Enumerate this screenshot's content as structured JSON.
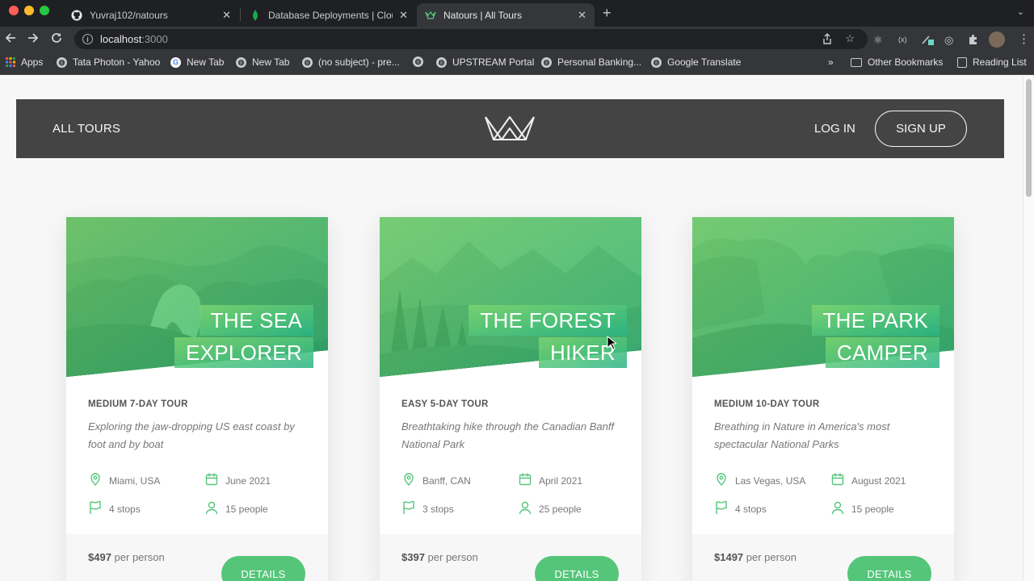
{
  "browser": {
    "tabs": [
      {
        "title": "Yuvraj102/natours",
        "icon": "github-icon"
      },
      {
        "title": "Database Deployments | Cloud",
        "icon": "mongodb-leaf-icon"
      },
      {
        "title": "Natours | All Tours",
        "icon": "natours-logo-icon"
      }
    ],
    "url_host": "localhost",
    "url_port": ":3000",
    "bookmarks": [
      {
        "label": "Apps",
        "icon": "apps-grid-icon"
      },
      {
        "label": "Tata Photon - Yahoo",
        "icon": "globe-icon"
      },
      {
        "label": "New Tab",
        "icon": "google-icon"
      },
      {
        "label": "New Tab",
        "icon": "globe-icon"
      },
      {
        "label": "(no subject) - pre...",
        "icon": "globe-icon"
      },
      {
        "label": "",
        "icon": "globe-icon"
      },
      {
        "label": "UPSTREAM Portal",
        "icon": "globe-icon"
      },
      {
        "label": "Personal Banking...",
        "icon": "globe-icon"
      },
      {
        "label": "Google Translate",
        "icon": "globe-icon"
      }
    ],
    "bookmarks_overflow": "»",
    "other_bookmarks": "Other Bookmarks",
    "reading_list": "Reading List"
  },
  "header": {
    "all_tours": "ALL TOURS",
    "login": "LOG IN",
    "signup": "SIGN UP"
  },
  "tours": [
    {
      "name": "THE SEA EXPLORER",
      "name_lines": [
        "THE SEA",
        "EXPLORER"
      ],
      "subheading": "MEDIUM 7-DAY TOUR",
      "summary": "Exploring the jaw-dropping US east coast by foot and by boat",
      "location": "Miami, USA",
      "date": "June 2021",
      "stops": "4 stops",
      "people": "15 people",
      "price": "$497",
      "price_unit": "per person",
      "button": "DETAILS"
    },
    {
      "name": "THE FOREST HIKER",
      "name_lines": [
        "THE FOREST",
        "HIKER"
      ],
      "subheading": "EASY 5-DAY TOUR",
      "summary": "Breathtaking hike through the Canadian Banff National Park",
      "location": "Banff, CAN",
      "date": "April 2021",
      "stops": "3 stops",
      "people": "25 people",
      "price": "$397",
      "price_unit": "per person",
      "button": "DETAILS"
    },
    {
      "name": "THE PARK CAMPER",
      "name_lines": [
        "THE PARK",
        "CAMPER"
      ],
      "subheading": "MEDIUM 10-DAY TOUR",
      "summary": "Breathing in Nature in America's most spectacular National Parks",
      "location": "Las Vegas, USA",
      "date": "August 2021",
      "stops": "4 stops",
      "people": "15 people",
      "price": "$1497",
      "price_unit": "per person",
      "button": "DETAILS"
    }
  ],
  "colors": {
    "brand_green": "#55c57a",
    "header_bg": "#444444",
    "page_bg": "#f7f7f7"
  }
}
